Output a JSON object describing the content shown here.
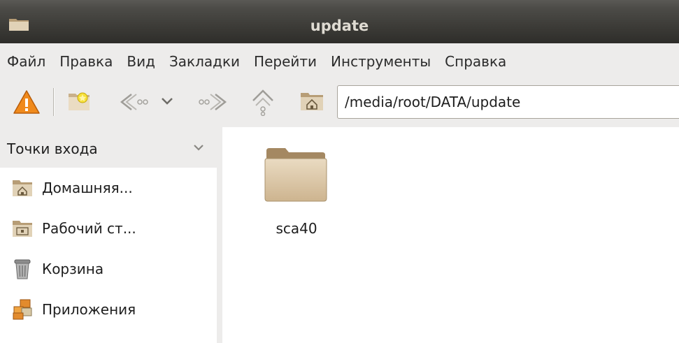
{
  "window": {
    "title": "update",
    "icon": "folder-icon"
  },
  "menubar": {
    "items": [
      {
        "label": "Файл"
      },
      {
        "label": "Правка"
      },
      {
        "label": "Вид"
      },
      {
        "label": "Закладки"
      },
      {
        "label": "Перейти"
      },
      {
        "label": "Инструменты"
      },
      {
        "label": "Справка"
      }
    ]
  },
  "toolbar": {
    "buttons": [
      {
        "icon": "warning-icon"
      },
      {
        "icon": "new-tab-icon"
      },
      {
        "icon": "back-arrow-icon"
      },
      {
        "icon": "chevron-down-icon"
      },
      {
        "icon": "forward-arrow-icon"
      },
      {
        "icon": "up-arrow-icon"
      },
      {
        "icon": "home-icon"
      }
    ],
    "location_path": "/media/root/DATA/update"
  },
  "sidebar": {
    "header_label": "Точки входа",
    "places": [
      {
        "label": "Домашняя...",
        "icon": "home-folder-icon"
      },
      {
        "label": "Рабочий ст...",
        "icon": "desktop-folder-icon"
      },
      {
        "label": "Корзина",
        "icon": "trash-icon"
      },
      {
        "label": "Приложения",
        "icon": "applications-icon"
      }
    ]
  },
  "files": [
    {
      "name": "sca40",
      "icon": "folder-icon"
    }
  ],
  "colors": {
    "titlebar": "#3c3b37",
    "title_text": "#dfdbd2",
    "chrome": "#edeceb",
    "folder_tan": "#c8b18f"
  }
}
